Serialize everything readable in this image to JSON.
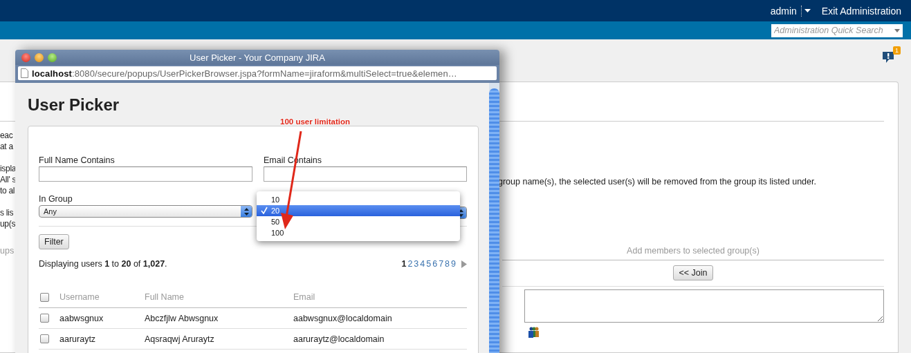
{
  "header": {
    "user": "admin",
    "exit_link": "Exit Administration"
  },
  "quick_search": {
    "placeholder": "Administration Quick Search"
  },
  "notifications": {
    "count": "1"
  },
  "page": {
    "left_fragments": [
      [
        "eac",
        "at a"
      ],
      [
        "ispla",
        "All' s",
        "to al"
      ],
      [
        "s lis",
        "up(s"
      ]
    ],
    "description": "group name(s), the selected user(s) will be removed from the group its listed under.",
    "groups_fragment": "ups",
    "add_members_label": "Add members to selected group(s)",
    "join_button": "<< Join"
  },
  "popup": {
    "window_title": "User Picker - Your Company JIRA",
    "url": "**localhost**:8080/secure/popups/UserPickerBrowser.jspa?formName=jiraform&multiSelect=true&elemen…",
    "heading": "User Picker",
    "fields": [
      {
        "label": "Full Name Contains"
      },
      {
        "label": "Email Contains"
      }
    ],
    "in_group": {
      "label": "In Group",
      "value": "Any"
    },
    "per_page_options": [
      {
        "label": "10",
        "selected": false
      },
      {
        "label": "20",
        "selected": true
      },
      {
        "label": "50",
        "selected": false
      },
      {
        "label": "100",
        "selected": false
      }
    ],
    "filter_button": "Filter",
    "summary": "Displaying users **1** to **20** of **1,027**.",
    "pages": [
      {
        "label": "1",
        "selected": true
      },
      {
        "label": "2",
        "selected": false
      },
      {
        "label": "3",
        "selected": false
      },
      {
        "label": "4",
        "selected": false
      },
      {
        "label": "5",
        "selected": false
      },
      {
        "label": "6",
        "selected": false
      },
      {
        "label": "7",
        "selected": false
      },
      {
        "label": "8",
        "selected": false
      },
      {
        "label": "9",
        "selected": false
      }
    ],
    "select_all": {
      "checked": false
    },
    "columns": [
      "Username",
      "Full Name",
      "Email"
    ],
    "rows": [
      {
        "username": "aabwsgnux",
        "full_name": "Abczfjlw Abwsgnux",
        "email": "aabwsgnux@localdomain",
        "checked": false
      },
      {
        "username": "aaruraytz",
        "full_name": "Aqsraqwj Aruraytz",
        "email": "aaruraytz@localdomain",
        "checked": false
      }
    ]
  },
  "annotation": {
    "text": "100 user limitation"
  }
}
